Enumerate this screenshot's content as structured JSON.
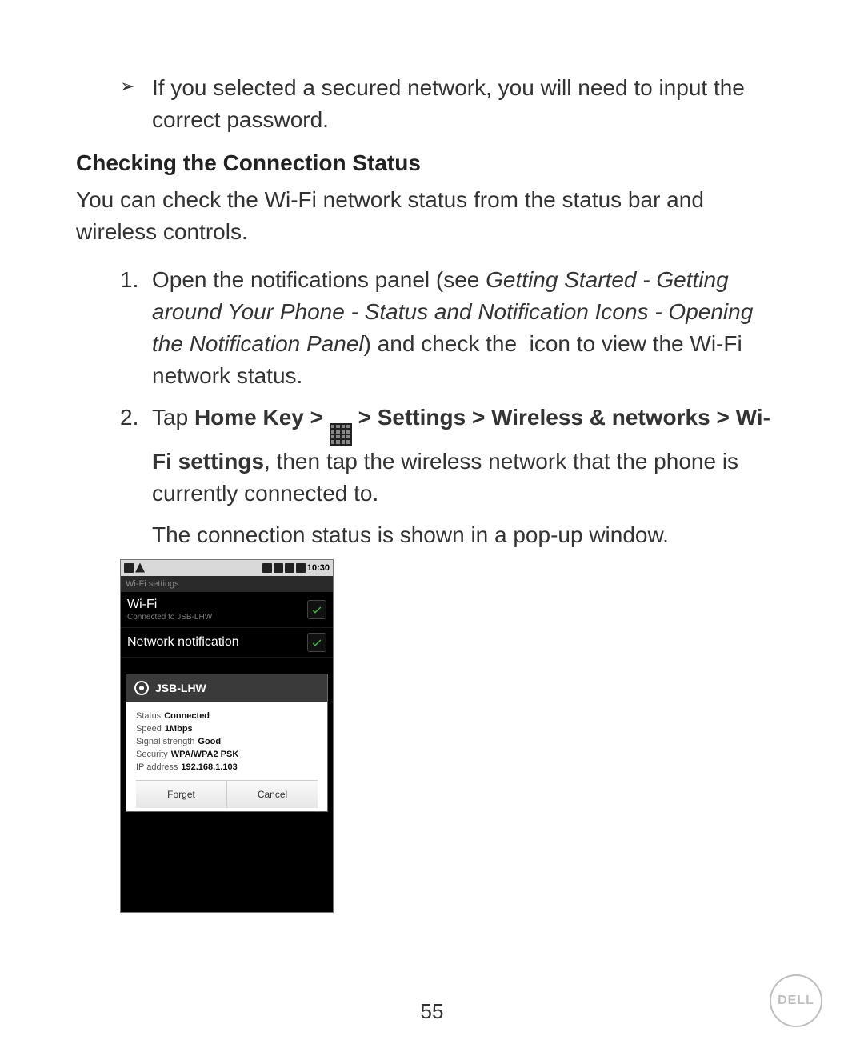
{
  "bullet": {
    "glyph": "➢",
    "text": "If you selected a secured network, you will need to input the correct password."
  },
  "heading": "Checking the Connection Status",
  "intro": "You can check the Wi-Fi network status from the status bar and wireless controls.",
  "step1": {
    "num": "1.",
    "pre": "Open the notifications panel (see ",
    "ref": "Getting Started - Getting around Your Phone - Status and Notification Icons - Opening the Notification Panel",
    "post_close": ") and check the",
    "after_icon": " icon to view the Wi-Fi network status."
  },
  "step2": {
    "num": "2.",
    "pre": "Tap ",
    "path_a": "Home Key > ",
    "path_b": " > Settings > Wireless & networks > Wi-Fi settings",
    "post": ", then tap the wireless network that the phone is currently connected to."
  },
  "note": "The connection status is shown in a pop-up window.",
  "phone": {
    "time": "10:30",
    "screen_title": "Wi-Fi settings",
    "row_wifi": {
      "title": "Wi-Fi",
      "sub": "Connected to JSB-LHW"
    },
    "row_notif": {
      "title": "Network notification"
    },
    "popup": {
      "ssid": "JSB-LHW",
      "status_label": "Status",
      "status_value": "Connected",
      "speed_label": "Speed",
      "speed_value": "1Mbps",
      "signal_label": "Signal strength",
      "signal_value": "Good",
      "security_label": "Security",
      "security_value": "WPA/WPA2 PSK",
      "ip_label": "IP address",
      "ip_value": "192.168.1.103",
      "forget": "Forget",
      "cancel": "Cancel"
    }
  },
  "footer": {
    "page_number": "55",
    "brand": "DELL"
  }
}
